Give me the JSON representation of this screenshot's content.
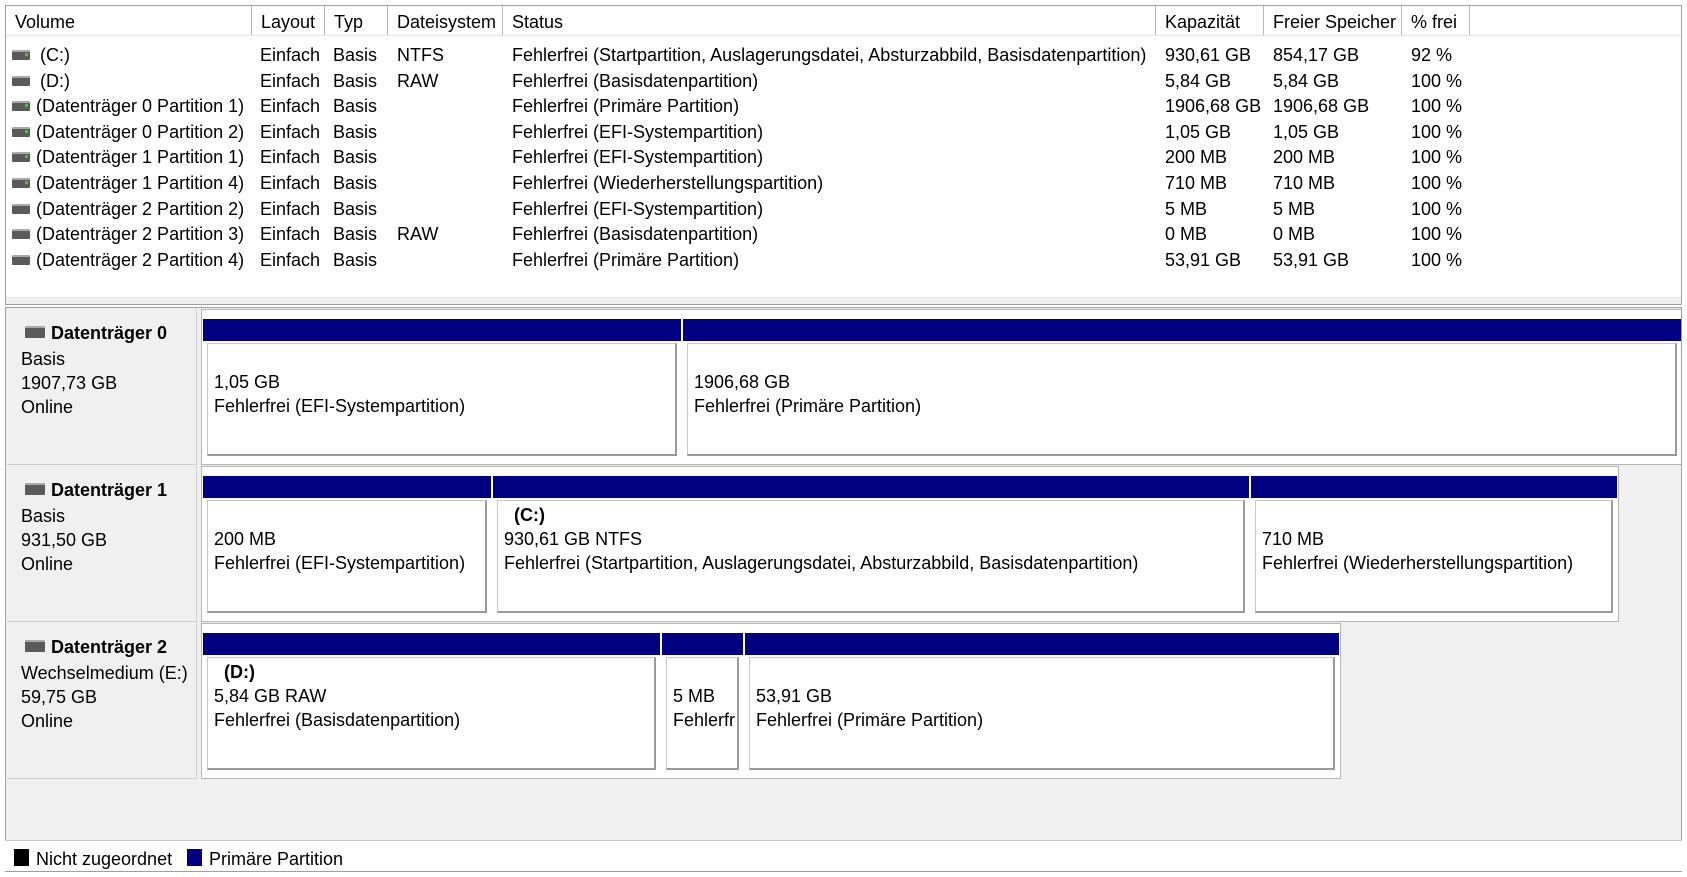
{
  "volume_table": {
    "columns": [
      "Volume",
      "Layout",
      "Typ",
      "Dateisystem",
      "Status",
      "Kapazität",
      "Freier Speicher",
      "% frei"
    ],
    "rows": [
      {
        "volume": "(C:)",
        "layout": "Einfach",
        "typ": "Basis",
        "fs": "NTFS",
        "status": "Fehlerfrei (Startpartition, Auslagerungsdatei, Absturzabbild, Basisdatenpartition)",
        "capacity": "930,61 GB",
        "free": "854,17 GB",
        "pct": "92 %"
      },
      {
        "volume": "(D:)",
        "layout": "Einfach",
        "typ": "Basis",
        "fs": "RAW",
        "status": "Fehlerfrei (Basisdatenpartition)",
        "capacity": "5,84 GB",
        "free": "5,84 GB",
        "pct": "100 %"
      },
      {
        "volume": "(Datenträger 0 Partition 1)",
        "layout": "Einfach",
        "typ": "Basis",
        "fs": "",
        "status": "Fehlerfrei (Primäre Partition)",
        "capacity": "1906,68 GB",
        "free": "1906,68 GB",
        "pct": "100 %"
      },
      {
        "volume": "(Datenträger 0 Partition 2)",
        "layout": "Einfach",
        "typ": "Basis",
        "fs": "",
        "status": "Fehlerfrei (EFI-Systempartition)",
        "capacity": "1,05 GB",
        "free": "1,05 GB",
        "pct": "100 %"
      },
      {
        "volume": "(Datenträger 1 Partition 1)",
        "layout": "Einfach",
        "typ": "Basis",
        "fs": "",
        "status": "Fehlerfrei (EFI-Systempartition)",
        "capacity": "200 MB",
        "free": "200 MB",
        "pct": "100 %"
      },
      {
        "volume": "(Datenträger 1 Partition 4)",
        "layout": "Einfach",
        "typ": "Basis",
        "fs": "",
        "status": "Fehlerfrei (Wiederherstellungspartition)",
        "capacity": "710 MB",
        "free": "710 MB",
        "pct": "100 %"
      },
      {
        "volume": "(Datenträger 2 Partition 2)",
        "layout": "Einfach",
        "typ": "Basis",
        "fs": "",
        "status": "Fehlerfrei (EFI-Systempartition)",
        "capacity": "5 MB",
        "free": "5 MB",
        "pct": "100 %"
      },
      {
        "volume": "(Datenträger 2 Partition 3)",
        "layout": "Einfach",
        "typ": "Basis",
        "fs": "RAW",
        "status": "Fehlerfrei (Basisdatenpartition)",
        "capacity": "0 MB",
        "free": "0 MB",
        "pct": "100 %"
      },
      {
        "volume": "(Datenträger 2 Partition 4)",
        "layout": "Einfach",
        "typ": "Basis",
        "fs": "",
        "status": "Fehlerfrei (Primäre Partition)",
        "capacity": "53,91 GB",
        "free": "53,91 GB",
        "pct": "100 %"
      }
    ]
  },
  "disks": [
    {
      "name": "Datenträger 0",
      "type": "Basis",
      "size": "1907,73 GB",
      "state": "Online",
      "partitions": [
        {
          "name": "",
          "size": "1,05 GB",
          "status": "Fehlerfrei (EFI-Systempartition)"
        },
        {
          "name": "",
          "size": "1906,68 GB",
          "status": "Fehlerfrei (Primäre Partition)"
        }
      ]
    },
    {
      "name": "Datenträger 1",
      "type": "Basis",
      "size": "931,50 GB",
      "state": "Online",
      "partitions": [
        {
          "name": "",
          "size": "200 MB",
          "status": "Fehlerfrei (EFI-Systempartition)"
        },
        {
          "name": "(C:)",
          "size": "930,61 GB NTFS",
          "status": "Fehlerfrei (Startpartition, Auslagerungsdatei, Absturzabbild, Basisdatenpartition)"
        },
        {
          "name": "",
          "size": "710 MB",
          "status": "Fehlerfrei (Wiederherstellungspartition)"
        }
      ]
    },
    {
      "name": "Datenträger 2",
      "type": "Wechselmedium (E:)",
      "size": "59,75 GB",
      "state": "Online",
      "partitions": [
        {
          "name": "(D:)",
          "size": "5,84 GB RAW",
          "status": "Fehlerfrei (Basisdatenpartition)"
        },
        {
          "name": "",
          "size": "5 MB",
          "status": "Fehlerfr"
        },
        {
          "name": "",
          "size": "53,91 GB",
          "status": "Fehlerfrei (Primäre Partition)"
        }
      ]
    }
  ],
  "legend": {
    "unallocated": "Nicht zugeordnet",
    "primary": "Primäre Partition",
    "unallocated_color": "#000000",
    "primary_color": "#000080"
  }
}
